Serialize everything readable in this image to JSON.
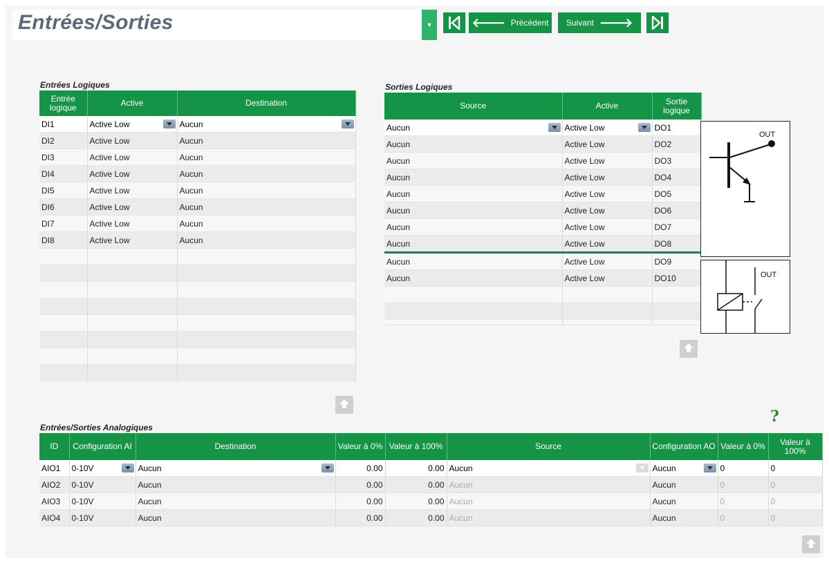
{
  "header": {
    "title": "Entrées/Sorties",
    "prev_label": "Précédent",
    "next_label": "Suivant"
  },
  "digital_inputs": {
    "title": "Entrées Logiques",
    "columns": [
      "Entrée logique",
      "Active",
      "Destination"
    ],
    "rows": [
      {
        "input": "DI1",
        "active": "Active Low",
        "destination": "Aucun"
      },
      {
        "input": "DI2",
        "active": "Active Low",
        "destination": "Aucun"
      },
      {
        "input": "DI3",
        "active": "Active Low",
        "destination": "Aucun"
      },
      {
        "input": "DI4",
        "active": "Active Low",
        "destination": "Aucun"
      },
      {
        "input": "DI5",
        "active": "Active Low",
        "destination": "Aucun"
      },
      {
        "input": "DI6",
        "active": "Active Low",
        "destination": "Aucun"
      },
      {
        "input": "DI7",
        "active": "Active Low",
        "destination": "Aucun"
      },
      {
        "input": "DI8",
        "active": "Active Low",
        "destination": "Aucun"
      }
    ]
  },
  "digital_outputs": {
    "title": "Sorties Logiques",
    "columns": [
      "Source",
      "Active",
      "Sortie logique"
    ],
    "rows": [
      {
        "source": "Aucun",
        "active": "Active Low",
        "output": "DO1"
      },
      {
        "source": "Aucun",
        "active": "Active Low",
        "output": "DO2"
      },
      {
        "source": "Aucun",
        "active": "Active Low",
        "output": "DO3"
      },
      {
        "source": "Aucun",
        "active": "Active Low",
        "output": "DO4"
      },
      {
        "source": "Aucun",
        "active": "Active Low",
        "output": "DO5"
      },
      {
        "source": "Aucun",
        "active": "Active Low",
        "output": "DO6"
      },
      {
        "source": "Aucun",
        "active": "Active Low",
        "output": "DO7"
      },
      {
        "source": "Aucun",
        "active": "Active Low",
        "output": "DO8"
      },
      {
        "source": "Aucun",
        "active": "Active Low",
        "output": "DO9"
      },
      {
        "source": "Aucun",
        "active": "Active Low",
        "output": "DO10"
      }
    ],
    "diagram_label": "OUT"
  },
  "analog_io": {
    "title": "Entrées/Sorties Analogiques",
    "columns": [
      "ID",
      "Configuration AI",
      "Destination",
      "Valeur à 0%",
      "Valeur à 100%",
      "Source",
      "Configuration AO",
      "Valeur à 0%",
      "Valeur à 100%"
    ],
    "rows": [
      {
        "id": "AIO1",
        "ai_config": "0-10V",
        "destination": "Aucun",
        "ai_0": "0.00",
        "ai_100": "0.00",
        "source": "Aucun",
        "ao_config": "Aucun",
        "ao_0": "0",
        "ao_100": "0"
      },
      {
        "id": "AIO2",
        "ai_config": "0-10V",
        "destination": "Aucun",
        "ai_0": "0.00",
        "ai_100": "0.00",
        "source": "Aucun",
        "ao_config": "Aucun",
        "ao_0": "0",
        "ao_100": "0"
      },
      {
        "id": "AIO3",
        "ai_config": "0-10V",
        "destination": "Aucun",
        "ai_0": "0.00",
        "ai_100": "0.00",
        "source": "Aucun",
        "ao_config": "Aucun",
        "ao_0": "0",
        "ao_100": "0"
      },
      {
        "id": "AIO4",
        "ai_config": "0-10V",
        "destination": "Aucun",
        "ai_0": "0.00",
        "ai_100": "0.00",
        "source": "Aucun",
        "ao_config": "Aucun",
        "ao_0": "0",
        "ao_100": "0"
      }
    ]
  },
  "help_symbol": "?",
  "colors": {
    "header_green": "#159447",
    "title_gray": "#5a6a7a"
  }
}
